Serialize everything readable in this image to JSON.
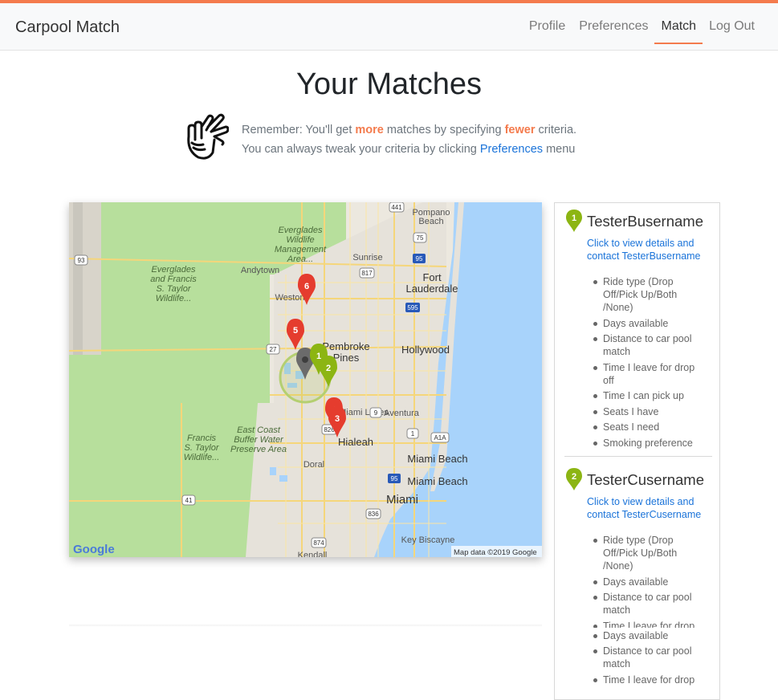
{
  "nav": {
    "brand": "Carpool Match",
    "items": [
      {
        "label": "Profile",
        "active": false
      },
      {
        "label": "Preferences",
        "active": false
      },
      {
        "label": "Match",
        "active": true
      },
      {
        "label": "Log Out",
        "active": false
      }
    ]
  },
  "page": {
    "title": "Your Matches",
    "tip_line1_prefix": "Remember: You'll get ",
    "tip_more": "more",
    "tip_line1_mid": " matches by specifying ",
    "tip_fewer": "fewer",
    "tip_line1_suffix": " criteria.",
    "tip_line2_prefix": "You can always tweak your criteria by clicking ",
    "tip_link": "Preferences",
    "tip_line2_suffix": " menu"
  },
  "map": {
    "labels": {
      "everglades_wildlife": [
        "Everglades",
        "Wildlife",
        "Management",
        "Area..."
      ],
      "everglades_francis": [
        "Everglades",
        "and Francis",
        "S. Taylor",
        "Wildlife..."
      ],
      "francis_taylor": [
        "Francis",
        "S. Taylor",
        "Wildlife..."
      ],
      "east_coast": [
        "East Coast",
        "Buffer Water",
        "Preserve Area"
      ],
      "andytown": "Andytown",
      "pompano": [
        "Pompano",
        "Beach"
      ],
      "sunrise": "Sunrise",
      "fort_lauderdale": [
        "Fort",
        "Lauderdale"
      ],
      "weston": "Weston",
      "pembroke": [
        "Pembroke",
        "Pines"
      ],
      "hollywood": "Hollywood",
      "aventura": "Aventura",
      "miami_lakes": "Miami Lakes",
      "hialeah": "Hialeah",
      "doral": "Doral",
      "miami_beach": "Miami Beach",
      "miami": "Miami",
      "key_biscayne": "Key Biscayne",
      "kendall": "Kendall",
      "google": "Google",
      "attribution": "Map data ©2019 Google"
    },
    "shields": [
      "93",
      "441",
      "75",
      "95",
      "817",
      "595",
      "27",
      "9",
      "826",
      "1",
      "A1A",
      "41",
      "836",
      "874",
      "95"
    ],
    "markers": [
      {
        "label": "6",
        "color": "#e53c2e"
      },
      {
        "label": "5",
        "color": "#e53c2e"
      },
      {
        "label": "1",
        "color": "#8cb513"
      },
      {
        "label": "2",
        "color": "#8cb513"
      },
      {
        "label": "4",
        "color": "#e53c2e"
      },
      {
        "label": "3",
        "color": "#e53c2e"
      }
    ]
  },
  "matches": [
    {
      "index": "1",
      "name": "TesterBusername",
      "link_line1": "Click to view details and",
      "link_line2": "contact TesterBusername",
      "criteria": [
        [
          "Ride type (Drop",
          "Off/Pick Up/Both",
          "/None)"
        ],
        [
          "Days available"
        ],
        [
          "Distance to car pool",
          "match"
        ],
        [
          "Time I leave for drop",
          "off"
        ],
        [
          "Time I can pick up"
        ],
        [
          "Seats I have"
        ],
        [
          "Seats I need"
        ],
        [
          "Smoking preference"
        ]
      ]
    },
    {
      "index": "2",
      "name": "TesterCusername",
      "link_line1": "Click to view details and",
      "link_line2": "contact TesterCusername",
      "criteria": [
        [
          "Ride type (Drop",
          "Off/Pick Up/Both",
          "/None)"
        ],
        [
          "Days available"
        ],
        [
          "Distance to car pool",
          "match"
        ],
        [
          "Time I leave for drop"
        ],
        [
          "Days available"
        ],
        [
          "Distance to car pool",
          "match"
        ],
        [
          "Time I leave for drop"
        ]
      ]
    }
  ],
  "colors": {
    "accent": "#f47b4d",
    "link": "#1a73d9",
    "marker_red": "#e53c2e",
    "marker_green": "#8cb513"
  }
}
